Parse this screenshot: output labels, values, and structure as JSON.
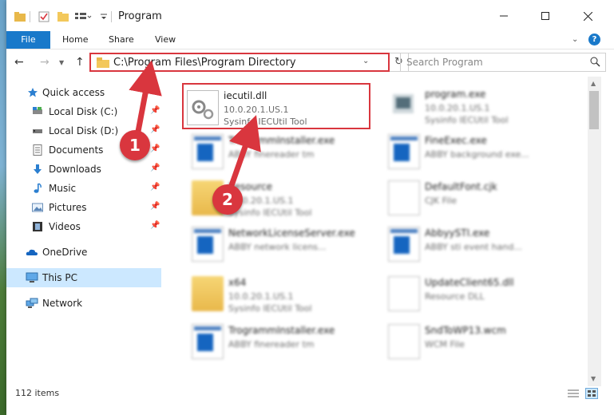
{
  "window": {
    "title": "Program"
  },
  "ribbon": {
    "tabs": [
      "File",
      "Home",
      "Share",
      "View"
    ],
    "help": "?"
  },
  "address": {
    "path": "C:\\Program Files\\Program Directory",
    "search_placeholder": "Search Program"
  },
  "navpane": {
    "items": [
      {
        "label": "Quick access",
        "icon": "star-icon"
      },
      {
        "label": "Local Disk (C:)",
        "icon": "drive-icon"
      },
      {
        "label": "Local Disk (D:)",
        "icon": "drive-icon"
      },
      {
        "label": "Documents",
        "icon": "documents-icon"
      },
      {
        "label": "Downloads",
        "icon": "downloads-icon"
      },
      {
        "label": "Music",
        "icon": "music-icon"
      },
      {
        "label": "Pictures",
        "icon": "pictures-icon"
      },
      {
        "label": "Videos",
        "icon": "videos-icon"
      },
      {
        "label": "OneDrive",
        "icon": "cloud-icon"
      },
      {
        "label": "This PC",
        "icon": "pc-icon"
      },
      {
        "label": "Network",
        "icon": "network-icon"
      }
    ]
  },
  "files": [
    {
      "name": "iecutil.dll",
      "line2": "10.0.20.1.US.1",
      "line3": "Sysinfo IECUtil Tool",
      "type": "dll"
    },
    {
      "name": "program.exe",
      "line2": "10.0.20.1.US.1",
      "line3": "Sysinfo IECUtil Tool",
      "type": "exe"
    },
    {
      "name": "TrogrammInstaller.exe",
      "line2": "ABBY finereader tm",
      "line3": "",
      "type": "app"
    },
    {
      "name": "FineExec.exe",
      "line2": "ABBY background exe...",
      "line3": "",
      "type": "app"
    },
    {
      "name": "Resource",
      "line2": "10.0.20.1.US.1",
      "line3": "Sysinfo IECUtil Tool",
      "type": "folder"
    },
    {
      "name": "DefaultFont.cjk",
      "line2": "CJK File",
      "line3": "",
      "type": "doc"
    },
    {
      "name": "NetworkLicenseServer.exe",
      "line2": "ABBY network licens...",
      "line3": "",
      "type": "app"
    },
    {
      "name": "AbbyySTI.exe",
      "line2": "ABBY sti event hand...",
      "line3": "",
      "type": "app"
    },
    {
      "name": "x64",
      "line2": "10.0.20.1.US.1",
      "line3": "Sysinfo IECUtil Tool",
      "type": "folder"
    },
    {
      "name": "UpdateClient65.dll",
      "line2": "Resource DLL",
      "line3": "",
      "type": "dll"
    },
    {
      "name": "TrogrammInstaller.exe",
      "line2": "ABBY finereader tm",
      "line3": "",
      "type": "app"
    },
    {
      "name": "SndToWP13.wcm",
      "line2": "WCM File",
      "line3": "",
      "type": "doc"
    }
  ],
  "status": {
    "count": "112 items"
  },
  "annotations": {
    "step1": "1",
    "step2": "2"
  },
  "colors": {
    "accent": "#1979ca",
    "highlight": "#d9363e",
    "selection": "#cce8ff"
  }
}
